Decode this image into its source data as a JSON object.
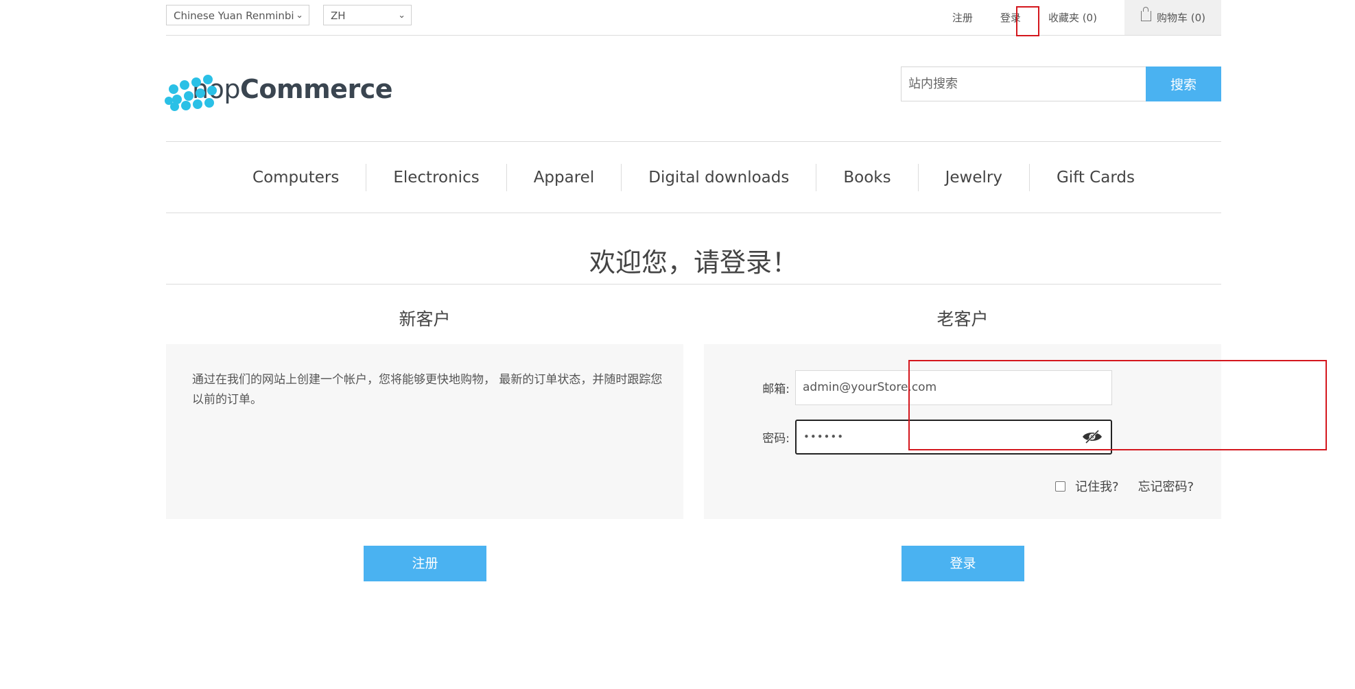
{
  "header": {
    "currency_selected": "Chinese Yuan Renminbi",
    "language_selected": "ZH",
    "links": {
      "register": "注册",
      "login": "登录",
      "wishlist": "收藏夹 (0)",
      "cart": "购物车 (0)"
    },
    "logo": {
      "prefix": "nop",
      "suffix": "Commerce"
    },
    "search": {
      "placeholder": "站内搜索",
      "button": "搜索"
    }
  },
  "nav": {
    "items": [
      "Computers",
      "Electronics",
      "Apparel",
      "Digital downloads",
      "Books",
      "Jewelry",
      "Gift Cards"
    ]
  },
  "page": {
    "title": "欢迎您，请登录！",
    "new_customer": {
      "heading": "新客户",
      "text": "通过在我们的网站上创建一个帐户，您将能够更快地购物， 最新的订单状态，并随时跟踪您以前的订单。",
      "button": "注册"
    },
    "returning_customer": {
      "heading": "老客户",
      "email_label": "邮箱:",
      "email_value": "admin@yourStore.com",
      "password_label": "密码:",
      "password_value": "••••••",
      "remember_label": "记住我?",
      "forgot_label": "忘记密码?",
      "button": "登录"
    }
  },
  "colors": {
    "accent": "#4ab2f1",
    "highlight": "#d4161d",
    "logo_dots": "#2ac0e6"
  }
}
